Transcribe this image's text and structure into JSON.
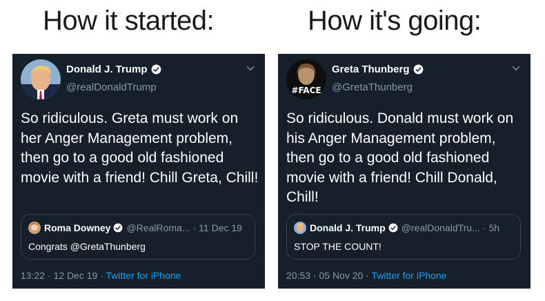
{
  "headings": {
    "left": "How it started:",
    "right": "How it's going:"
  },
  "colors": {
    "tweet_bg": "#15202b",
    "muted": "#8899a6",
    "link": "#1da1f2",
    "border": "#38444d"
  },
  "tweets": [
    {
      "name": "Donald J. Trump",
      "handle": "@realDonaldTrump",
      "verified": true,
      "avatar_icon": "trump-avatar",
      "text": "So ridiculous. Greta must work on her Anger Management problem, then go to a good old fashioned movie with a friend! Chill Greta, Chill!",
      "quote": {
        "name": "Roma Downey",
        "handle": "@RealRoma...",
        "date": "11 Dec 19",
        "text": "Congrats @GretaThunberg"
      },
      "timestamp": "13:22 · 12 Dec 19",
      "source": "Twitter for iPhone"
    },
    {
      "name": "Greta Thunberg",
      "handle": "@GretaThunberg",
      "verified": true,
      "avatar_icon": "greta-avatar",
      "avatar_text": "#FACE",
      "text": "So ridiculous. Donald must work on his Anger Management problem, then go to a good old fashioned movie with a friend! Chill Donald, Chill!",
      "quote": {
        "name": "Donald J. Trump",
        "handle": "@realDonaldTru...",
        "date": "5h",
        "text": "STOP THE COUNT!"
      },
      "timestamp": "20:53 · 05 Nov 20",
      "source": "Twitter for iPhone"
    }
  ]
}
